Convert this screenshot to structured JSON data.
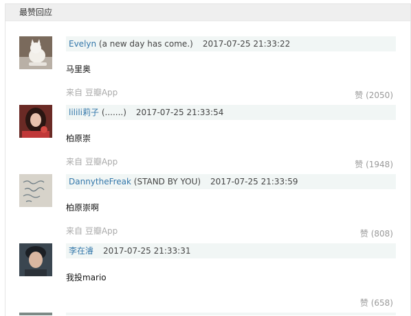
{
  "section": {
    "title": "最赞回应"
  },
  "colors": {
    "link": "#3377aa",
    "meta_bg": "#f1f6f5",
    "muted": "#aaaaaa"
  },
  "comments": [
    {
      "author": "Evelyn",
      "signature": " (a new day has come.)",
      "time": "2017-07-25 21:33:22",
      "content": "马里奥",
      "source": "来自 豆瓣App",
      "votes": "赞 (2050)",
      "avatar_icon": "cat-photo-avatar-icon"
    },
    {
      "author": "lilili莉子",
      "signature": " (.......)",
      "time": "2017-07-25 21:33:54",
      "content": "柏原崇",
      "source": "来自 豆瓣App",
      "votes": "赞 (1948)",
      "avatar_icon": "woman-portrait-avatar-icon"
    },
    {
      "author": "DannytheFreak",
      "signature": " (STAND BY YOU)",
      "time": "2017-07-25 21:33:59",
      "content": "柏原崇啊",
      "source": "来自 豆瓣App",
      "votes": "赞 (808)",
      "avatar_icon": "handwriting-avatar-icon"
    },
    {
      "author": "李在濬",
      "signature": "",
      "time": "2017-07-25 21:33:31",
      "content": "我投mario",
      "source": "",
      "votes": "赞 (658)",
      "avatar_icon": "man-portrait-avatar-icon"
    }
  ]
}
